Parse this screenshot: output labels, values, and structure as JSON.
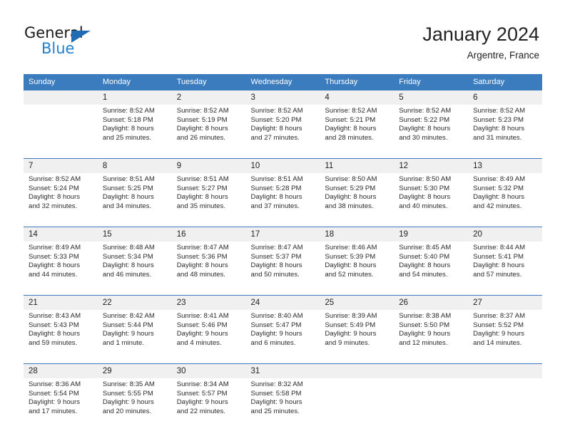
{
  "brand": {
    "name_top": "General",
    "name_bottom": "Blue",
    "triangle_color": "#1f6cb4",
    "blue_color": "#1f7fd0"
  },
  "header": {
    "title": "January 2024",
    "subtitle": "Argentre, France"
  },
  "theme": {
    "header_blue": "#3a7cbe",
    "daynum_gray": "#f0f0f0",
    "cell_white": "#ffffff",
    "text_dark": "#2b2b2b"
  },
  "weekday_headers": [
    "Sunday",
    "Monday",
    "Tuesday",
    "Wednesday",
    "Thursday",
    "Friday",
    "Saturday"
  ],
  "weeks": [
    {
      "days": [
        {
          "num": "",
          "sunrise": "",
          "sunset": "",
          "daylight_1": "",
          "daylight_2": ""
        },
        {
          "num": "1",
          "sunrise": "Sunrise: 8:52 AM",
          "sunset": "Sunset: 5:18 PM",
          "daylight_1": "Daylight: 8 hours",
          "daylight_2": "and 25 minutes."
        },
        {
          "num": "2",
          "sunrise": "Sunrise: 8:52 AM",
          "sunset": "Sunset: 5:19 PM",
          "daylight_1": "Daylight: 8 hours",
          "daylight_2": "and 26 minutes."
        },
        {
          "num": "3",
          "sunrise": "Sunrise: 8:52 AM",
          "sunset": "Sunset: 5:20 PM",
          "daylight_1": "Daylight: 8 hours",
          "daylight_2": "and 27 minutes."
        },
        {
          "num": "4",
          "sunrise": "Sunrise: 8:52 AM",
          "sunset": "Sunset: 5:21 PM",
          "daylight_1": "Daylight: 8 hours",
          "daylight_2": "and 28 minutes."
        },
        {
          "num": "5",
          "sunrise": "Sunrise: 8:52 AM",
          "sunset": "Sunset: 5:22 PM",
          "daylight_1": "Daylight: 8 hours",
          "daylight_2": "and 30 minutes."
        },
        {
          "num": "6",
          "sunrise": "Sunrise: 8:52 AM",
          "sunset": "Sunset: 5:23 PM",
          "daylight_1": "Daylight: 8 hours",
          "daylight_2": "and 31 minutes."
        }
      ]
    },
    {
      "days": [
        {
          "num": "7",
          "sunrise": "Sunrise: 8:52 AM",
          "sunset": "Sunset: 5:24 PM",
          "daylight_1": "Daylight: 8 hours",
          "daylight_2": "and 32 minutes."
        },
        {
          "num": "8",
          "sunrise": "Sunrise: 8:51 AM",
          "sunset": "Sunset: 5:25 PM",
          "daylight_1": "Daylight: 8 hours",
          "daylight_2": "and 34 minutes."
        },
        {
          "num": "9",
          "sunrise": "Sunrise: 8:51 AM",
          "sunset": "Sunset: 5:27 PM",
          "daylight_1": "Daylight: 8 hours",
          "daylight_2": "and 35 minutes."
        },
        {
          "num": "10",
          "sunrise": "Sunrise: 8:51 AM",
          "sunset": "Sunset: 5:28 PM",
          "daylight_1": "Daylight: 8 hours",
          "daylight_2": "and 37 minutes."
        },
        {
          "num": "11",
          "sunrise": "Sunrise: 8:50 AM",
          "sunset": "Sunset: 5:29 PM",
          "daylight_1": "Daylight: 8 hours",
          "daylight_2": "and 38 minutes."
        },
        {
          "num": "12",
          "sunrise": "Sunrise: 8:50 AM",
          "sunset": "Sunset: 5:30 PM",
          "daylight_1": "Daylight: 8 hours",
          "daylight_2": "and 40 minutes."
        },
        {
          "num": "13",
          "sunrise": "Sunrise: 8:49 AM",
          "sunset": "Sunset: 5:32 PM",
          "daylight_1": "Daylight: 8 hours",
          "daylight_2": "and 42 minutes."
        }
      ]
    },
    {
      "days": [
        {
          "num": "14",
          "sunrise": "Sunrise: 8:49 AM",
          "sunset": "Sunset: 5:33 PM",
          "daylight_1": "Daylight: 8 hours",
          "daylight_2": "and 44 minutes."
        },
        {
          "num": "15",
          "sunrise": "Sunrise: 8:48 AM",
          "sunset": "Sunset: 5:34 PM",
          "daylight_1": "Daylight: 8 hours",
          "daylight_2": "and 46 minutes."
        },
        {
          "num": "16",
          "sunrise": "Sunrise: 8:47 AM",
          "sunset": "Sunset: 5:36 PM",
          "daylight_1": "Daylight: 8 hours",
          "daylight_2": "and 48 minutes."
        },
        {
          "num": "17",
          "sunrise": "Sunrise: 8:47 AM",
          "sunset": "Sunset: 5:37 PM",
          "daylight_1": "Daylight: 8 hours",
          "daylight_2": "and 50 minutes."
        },
        {
          "num": "18",
          "sunrise": "Sunrise: 8:46 AM",
          "sunset": "Sunset: 5:39 PM",
          "daylight_1": "Daylight: 8 hours",
          "daylight_2": "and 52 minutes."
        },
        {
          "num": "19",
          "sunrise": "Sunrise: 8:45 AM",
          "sunset": "Sunset: 5:40 PM",
          "daylight_1": "Daylight: 8 hours",
          "daylight_2": "and 54 minutes."
        },
        {
          "num": "20",
          "sunrise": "Sunrise: 8:44 AM",
          "sunset": "Sunset: 5:41 PM",
          "daylight_1": "Daylight: 8 hours",
          "daylight_2": "and 57 minutes."
        }
      ]
    },
    {
      "days": [
        {
          "num": "21",
          "sunrise": "Sunrise: 8:43 AM",
          "sunset": "Sunset: 5:43 PM",
          "daylight_1": "Daylight: 8 hours",
          "daylight_2": "and 59 minutes."
        },
        {
          "num": "22",
          "sunrise": "Sunrise: 8:42 AM",
          "sunset": "Sunset: 5:44 PM",
          "daylight_1": "Daylight: 9 hours",
          "daylight_2": "and 1 minute."
        },
        {
          "num": "23",
          "sunrise": "Sunrise: 8:41 AM",
          "sunset": "Sunset: 5:46 PM",
          "daylight_1": "Daylight: 9 hours",
          "daylight_2": "and 4 minutes."
        },
        {
          "num": "24",
          "sunrise": "Sunrise: 8:40 AM",
          "sunset": "Sunset: 5:47 PM",
          "daylight_1": "Daylight: 9 hours",
          "daylight_2": "and 6 minutes."
        },
        {
          "num": "25",
          "sunrise": "Sunrise: 8:39 AM",
          "sunset": "Sunset: 5:49 PM",
          "daylight_1": "Daylight: 9 hours",
          "daylight_2": "and 9 minutes."
        },
        {
          "num": "26",
          "sunrise": "Sunrise: 8:38 AM",
          "sunset": "Sunset: 5:50 PM",
          "daylight_1": "Daylight: 9 hours",
          "daylight_2": "and 12 minutes."
        },
        {
          "num": "27",
          "sunrise": "Sunrise: 8:37 AM",
          "sunset": "Sunset: 5:52 PM",
          "daylight_1": "Daylight: 9 hours",
          "daylight_2": "and 14 minutes."
        }
      ]
    },
    {
      "days": [
        {
          "num": "28",
          "sunrise": "Sunrise: 8:36 AM",
          "sunset": "Sunset: 5:54 PM",
          "daylight_1": "Daylight: 9 hours",
          "daylight_2": "and 17 minutes."
        },
        {
          "num": "29",
          "sunrise": "Sunrise: 8:35 AM",
          "sunset": "Sunset: 5:55 PM",
          "daylight_1": "Daylight: 9 hours",
          "daylight_2": "and 20 minutes."
        },
        {
          "num": "30",
          "sunrise": "Sunrise: 8:34 AM",
          "sunset": "Sunset: 5:57 PM",
          "daylight_1": "Daylight: 9 hours",
          "daylight_2": "and 22 minutes."
        },
        {
          "num": "31",
          "sunrise": "Sunrise: 8:32 AM",
          "sunset": "Sunset: 5:58 PM",
          "daylight_1": "Daylight: 9 hours",
          "daylight_2": "and 25 minutes."
        },
        {
          "num": "",
          "sunrise": "",
          "sunset": "",
          "daylight_1": "",
          "daylight_2": ""
        },
        {
          "num": "",
          "sunrise": "",
          "sunset": "",
          "daylight_1": "",
          "daylight_2": ""
        },
        {
          "num": "",
          "sunrise": "",
          "sunset": "",
          "daylight_1": "",
          "daylight_2": ""
        }
      ]
    }
  ]
}
